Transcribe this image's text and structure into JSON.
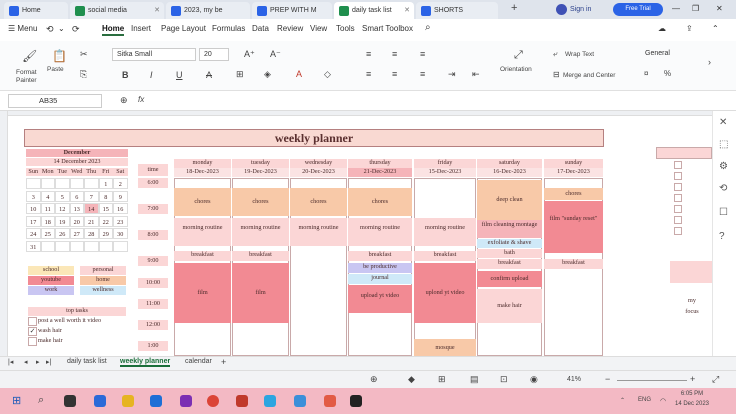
{
  "browser_tabs": [
    {
      "label": "Home",
      "color": "#2b63e6"
    },
    {
      "label": "social media",
      "color": "#1f8f4e"
    },
    {
      "label": "2023, my be",
      "color": "#2b63e6"
    },
    {
      "label": "PREP WITH M",
      "color": "#2b63e6"
    },
    {
      "label": "daily task list",
      "color": "#1f8f4e"
    },
    {
      "label": "SHORTS",
      "color": "#2b63e6"
    }
  ],
  "header": {
    "sign_in": "Sign in",
    "free_trial": "Free Trial"
  },
  "menu": {
    "app_menu": "Menu",
    "items": [
      "Home",
      "Insert",
      "Page Layout",
      "Formulas",
      "Data",
      "Review",
      "View",
      "Tools",
      "Smart Toolbox"
    ]
  },
  "ribbon": {
    "format_painter": "Format Painter",
    "paste": "Paste",
    "font_name": "Sitka Small",
    "font_size": "20",
    "orientation": "Orientation",
    "wrap_text": "Wrap Text",
    "merge_center": "Merge and Center",
    "number_format": "General"
  },
  "formula_bar": {
    "cell_ref": "AB35",
    "fx": "fx"
  },
  "planner": {
    "title": "weekly planner",
    "time_label": "time",
    "days": [
      {
        "name": "monday",
        "date": "18-Dec-2023"
      },
      {
        "name": "tuesday",
        "date": "19-Dec-2023"
      },
      {
        "name": "wednesday",
        "date": "20-Dec-2023"
      },
      {
        "name": "thursday",
        "date": "21-Dec-2023"
      },
      {
        "name": "friday",
        "date": "15-Dec-2023"
      },
      {
        "name": "saturday",
        "date": "16-Dec-2023"
      },
      {
        "name": "sunday",
        "date": "17-Dec-2023"
      }
    ],
    "times": [
      "6:00",
      "7:00",
      "8:00",
      "9:00",
      "10:00",
      "11:00",
      "12:00",
      "1:00",
      "2:00"
    ],
    "entries": {
      "chores": "chores",
      "morning_routine": "morning routine",
      "breakfast": "breakfast",
      "film": "film",
      "deep_clean": "deep clean",
      "film_cleaning": "film cleaning montage",
      "exfoliate": "exfoliate & shave",
      "bath": "bath",
      "film_sunday": "film \"sunday reset\"",
      "be_productive": "be productive",
      "journal": "journal",
      "upload_yt_video": "upload yt video",
      "upload_yt_video2": "uplond yt video",
      "confirm_upload": "confirm upload",
      "make_hair": "make hair",
      "mosque": "mosque"
    }
  },
  "calendar": {
    "month": "December",
    "today": "14 December 2023",
    "weekdays": [
      "Sun",
      "Mon",
      "Tue",
      "Wed",
      "Thu",
      "Fri",
      "Sat"
    ],
    "rows": [
      [
        "",
        "",
        "",
        "",
        "",
        "1",
        "2"
      ],
      [
        "3",
        "4",
        "5",
        "6",
        "7",
        "8",
        "9"
      ],
      [
        "10",
        "11",
        "12",
        "13",
        "14",
        "15",
        "16"
      ],
      [
        "17",
        "18",
        "19",
        "20",
        "21",
        "22",
        "23"
      ],
      [
        "24",
        "25",
        "26",
        "27",
        "28",
        "29",
        "30"
      ],
      [
        "31",
        "",
        "",
        "",
        "",
        "",
        ""
      ]
    ]
  },
  "legend": [
    {
      "label": "school",
      "color": "#fbe7b8"
    },
    {
      "label": "personal",
      "color": "#fbd6d6"
    },
    {
      "label": "youtube",
      "color": "#f28a93"
    },
    {
      "label": "home",
      "color": "#f8c9a8"
    },
    {
      "label": "work",
      "color": "#c9c6f2"
    },
    {
      "label": "wellness",
      "color": "#cfe9f8"
    }
  ],
  "top_tasks": {
    "title": "top tasks",
    "items": [
      {
        "label": "post a well worth it video",
        "checked": false
      },
      {
        "label": "wash hair",
        "checked": true
      },
      {
        "label": "make hair",
        "checked": false
      }
    ]
  },
  "right_partial": {
    "line1": "my",
    "line2": "focus"
  },
  "sheet_tabs": [
    "daily task list",
    "weekly planner",
    "calendar"
  ],
  "status": {
    "zoom": "41%"
  },
  "taskbar": {
    "language": "ENG",
    "time": "6:05 PM",
    "date": "14 Dec 2023"
  }
}
